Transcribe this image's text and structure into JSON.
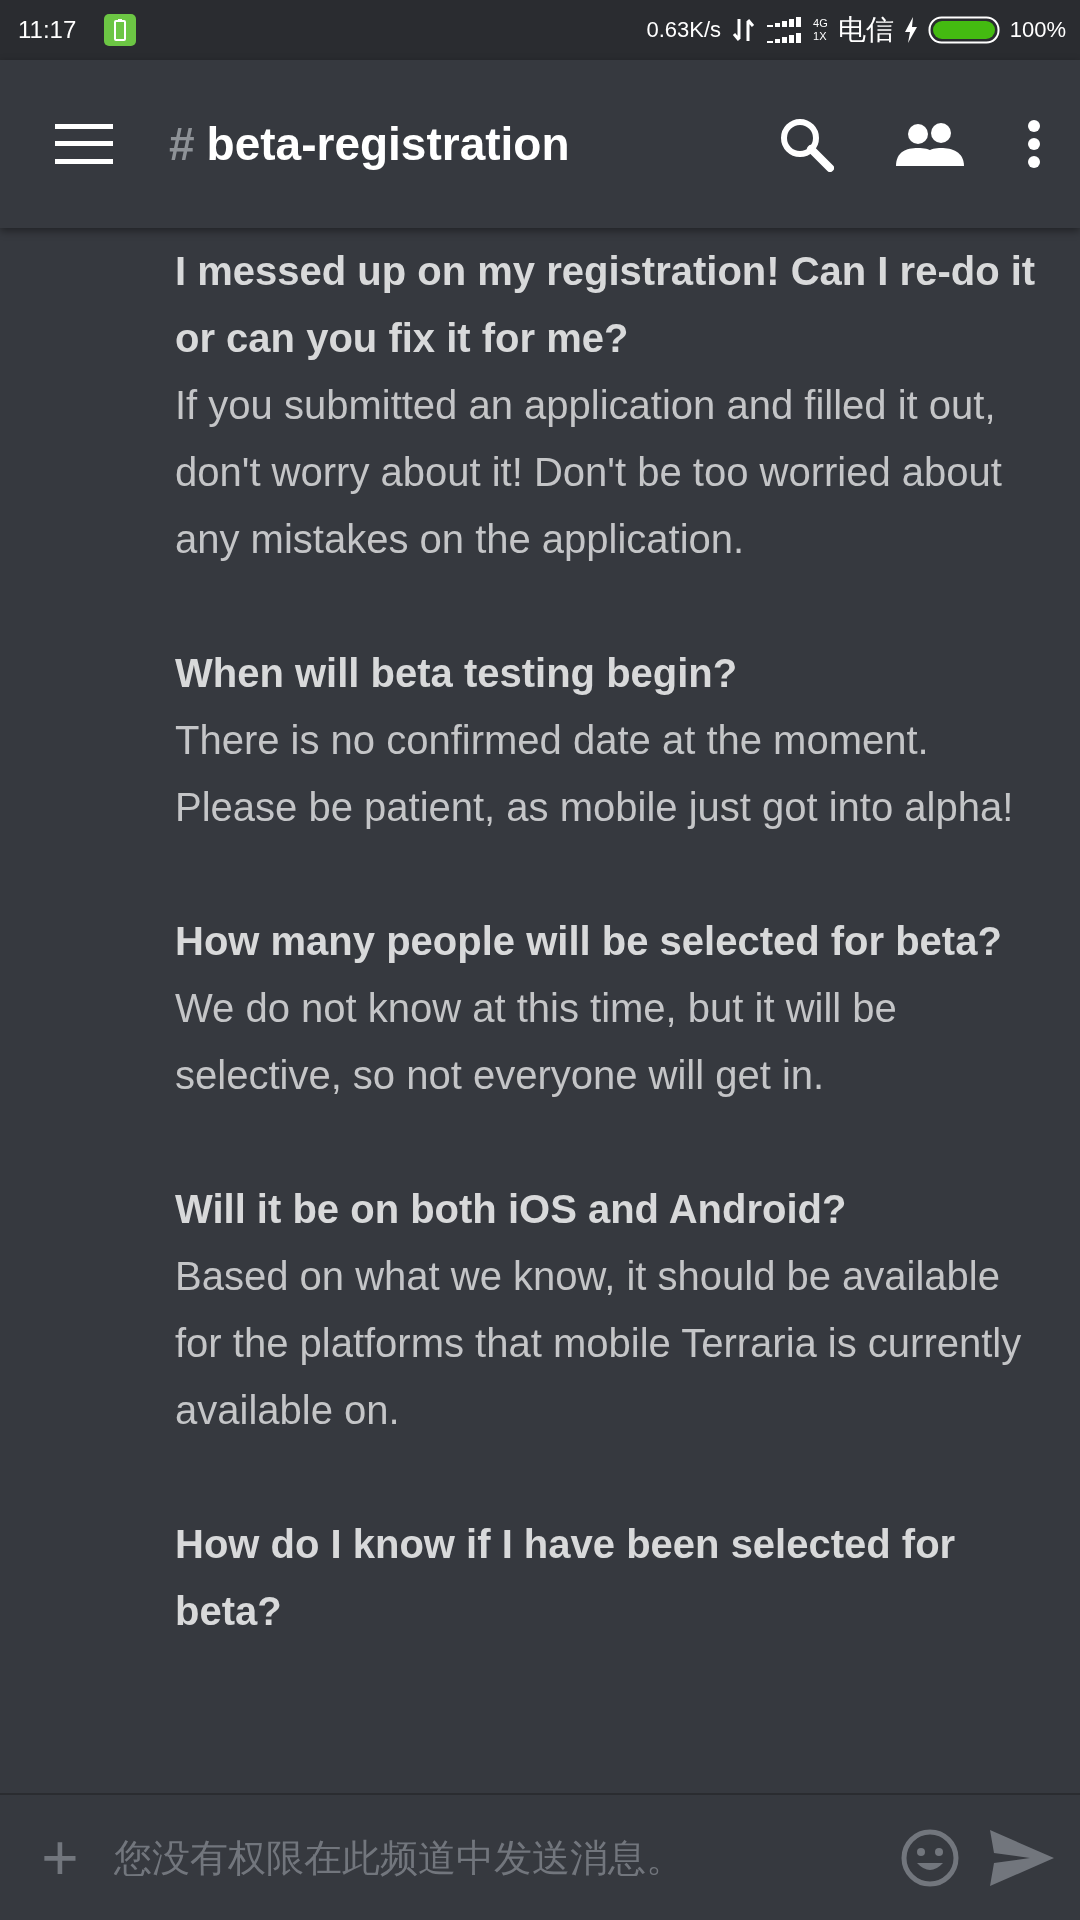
{
  "status_bar": {
    "time": "11:17",
    "speed": "0.63K/s",
    "network_top": "4G",
    "network_bottom": "1X",
    "carrier": "电信",
    "battery": "100%"
  },
  "header": {
    "hash": "#",
    "channel": "beta-registration"
  },
  "messages": [
    {
      "question": "I messed up on my registration! Can I re-do it or can you fix it for me?",
      "answer": "If you submitted an application and filled it out, don't worry about it! Don't be too worried about any mistakes on the application."
    },
    {
      "question": "When will beta testing begin?",
      "answer": "There is no confirmed date at the moment. Please be patient, as mobile just got into alpha!"
    },
    {
      "question": "How many people will be selected for beta?",
      "answer": "We do not know at this time, but it will be selective, so not everyone will get in."
    },
    {
      "question": "Will it be on both iOS and Android?",
      "answer": "Based on what we know, it should be available for the platforms that mobile Terraria is currently available on."
    },
    {
      "question": "How do I know if I have been selected for beta?"
    }
  ],
  "composer": {
    "add": "+",
    "placeholder": "您没有权限在此频道中发送消息。"
  }
}
